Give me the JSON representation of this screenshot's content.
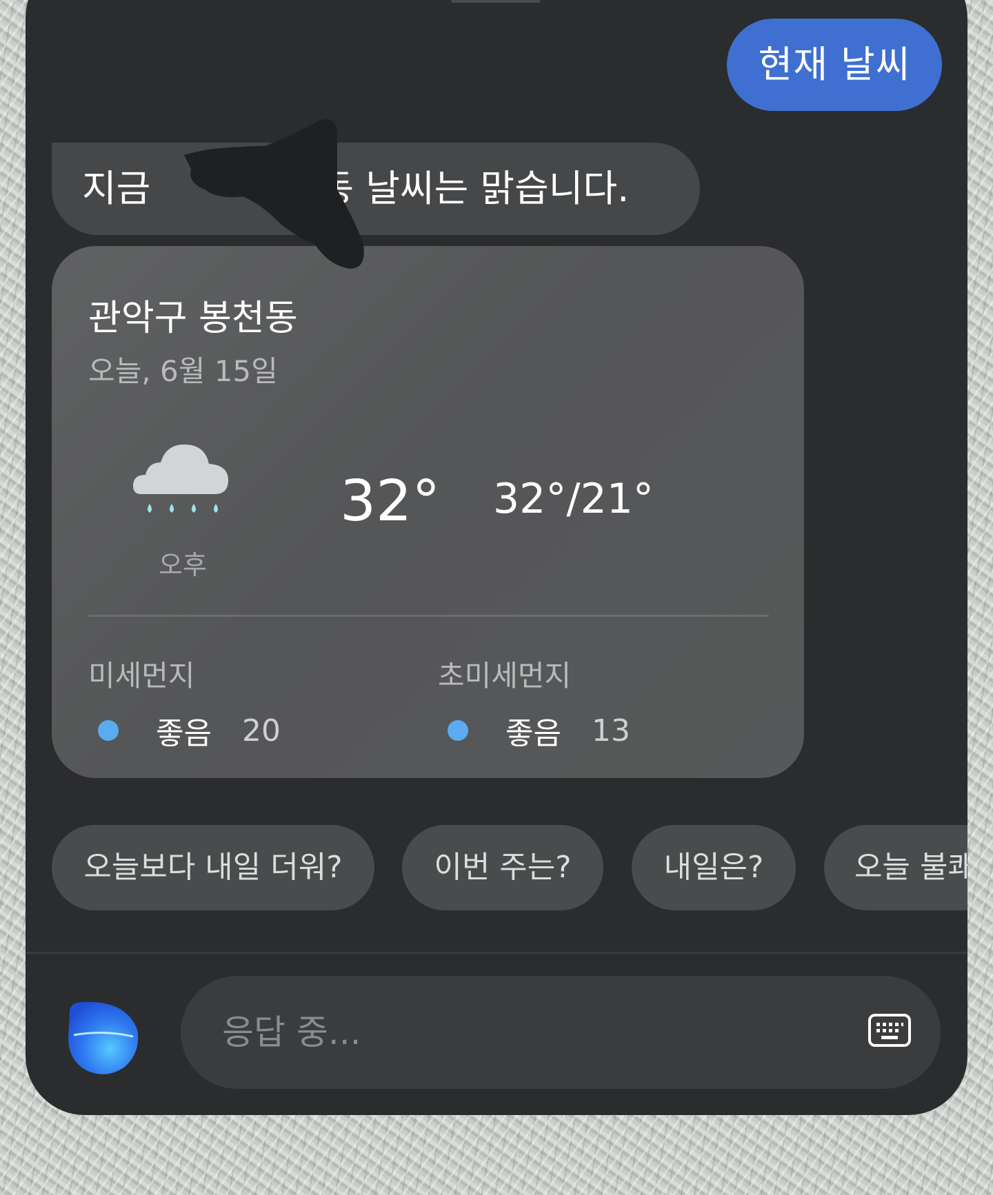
{
  "user_message": {
    "text": "현재 날씨"
  },
  "assistant_message": {
    "text_start": "지금",
    "text_end": "동 날씨는 맑습니다."
  },
  "weather_card": {
    "location": "관악구 봉천동",
    "date": "오늘,  6월 15일",
    "condition_icon": "cloud-rain-icon",
    "period": "오후",
    "current_temp": "32°",
    "high_low": "32°/21°",
    "air_quality": [
      {
        "title": "미세먼지",
        "status": "좋음",
        "value": "20",
        "color": "#5aabf2"
      },
      {
        "title": "초미세먼지",
        "status": "좋음",
        "value": "13",
        "color": "#5aabf2"
      }
    ]
  },
  "suggestions": [
    {
      "label": "오늘보다 내일 더워?"
    },
    {
      "label": "이번 주는?"
    },
    {
      "label": "내일은?"
    },
    {
      "label": "오늘 불쾌"
    }
  ],
  "input": {
    "placeholder": "응답 중...",
    "keyboard_icon": "keyboard-icon"
  },
  "colors": {
    "accent": "#3f6fd1",
    "panel": "#2b2c2d",
    "card": "#5a5b5c",
    "air_good": "#5aabf2"
  }
}
